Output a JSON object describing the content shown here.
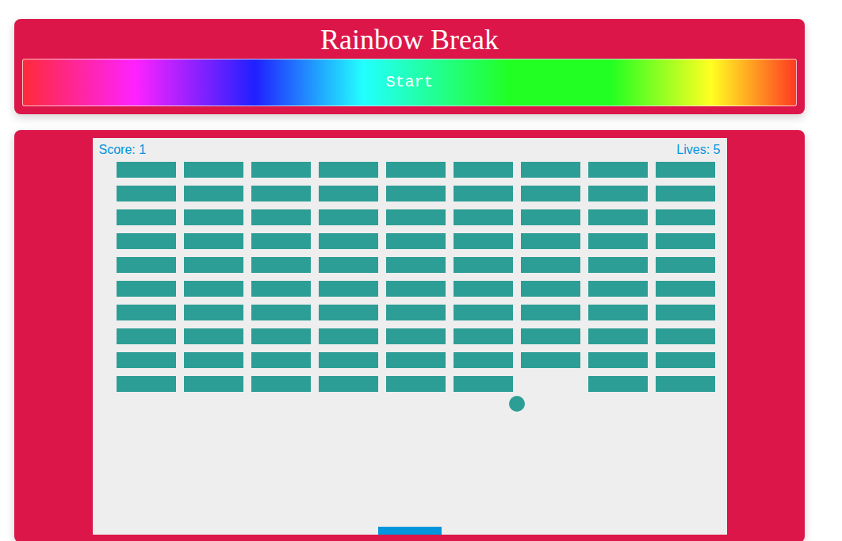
{
  "title": "Rainbow Break",
  "start_button": "Start",
  "score": "Score: 1",
  "lives": "Lives: 5",
  "bricks": [
    [
      {
        "broken": false
      },
      {
        "broken": false
      },
      {
        "broken": false
      },
      {
        "broken": false
      },
      {
        "broken": false
      },
      {
        "broken": false
      },
      {
        "broken": false
      },
      {
        "broken": false
      },
      {
        "broken": false
      }
    ],
    [
      {
        "broken": false
      },
      {
        "broken": false
      },
      {
        "broken": false
      },
      {
        "broken": false
      },
      {
        "broken": false
      },
      {
        "broken": false
      },
      {
        "broken": false
      },
      {
        "broken": false
      },
      {
        "broken": false
      }
    ],
    [
      {
        "broken": false
      },
      {
        "broken": false
      },
      {
        "broken": false
      },
      {
        "broken": false
      },
      {
        "broken": false
      },
      {
        "broken": false
      },
      {
        "broken": false
      },
      {
        "broken": false
      },
      {
        "broken": false
      }
    ],
    [
      {
        "broken": false
      },
      {
        "broken": false
      },
      {
        "broken": false
      },
      {
        "broken": false
      },
      {
        "broken": false
      },
      {
        "broken": false
      },
      {
        "broken": false
      },
      {
        "broken": false
      },
      {
        "broken": false
      }
    ],
    [
      {
        "broken": false
      },
      {
        "broken": false
      },
      {
        "broken": false
      },
      {
        "broken": false
      },
      {
        "broken": false
      },
      {
        "broken": false
      },
      {
        "broken": false
      },
      {
        "broken": false
      },
      {
        "broken": false
      }
    ],
    [
      {
        "broken": false
      },
      {
        "broken": false
      },
      {
        "broken": false
      },
      {
        "broken": false
      },
      {
        "broken": false
      },
      {
        "broken": false
      },
      {
        "broken": false
      },
      {
        "broken": false
      },
      {
        "broken": false
      }
    ],
    [
      {
        "broken": false
      },
      {
        "broken": false
      },
      {
        "broken": false
      },
      {
        "broken": false
      },
      {
        "broken": false
      },
      {
        "broken": false
      },
      {
        "broken": false
      },
      {
        "broken": false
      },
      {
        "broken": false
      }
    ],
    [
      {
        "broken": false
      },
      {
        "broken": false
      },
      {
        "broken": false
      },
      {
        "broken": false
      },
      {
        "broken": false
      },
      {
        "broken": false
      },
      {
        "broken": false
      },
      {
        "broken": false
      },
      {
        "broken": false
      }
    ],
    [
      {
        "broken": false
      },
      {
        "broken": false
      },
      {
        "broken": false
      },
      {
        "broken": false
      },
      {
        "broken": false
      },
      {
        "broken": false
      },
      {
        "broken": false
      },
      {
        "broken": false
      },
      {
        "broken": false
      }
    ],
    [
      {
        "broken": false
      },
      {
        "broken": false
      },
      {
        "broken": false
      },
      {
        "broken": false
      },
      {
        "broken": false
      },
      {
        "broken": false
      },
      {
        "broken": true
      },
      {
        "broken": false
      },
      {
        "broken": false
      }
    ]
  ]
}
